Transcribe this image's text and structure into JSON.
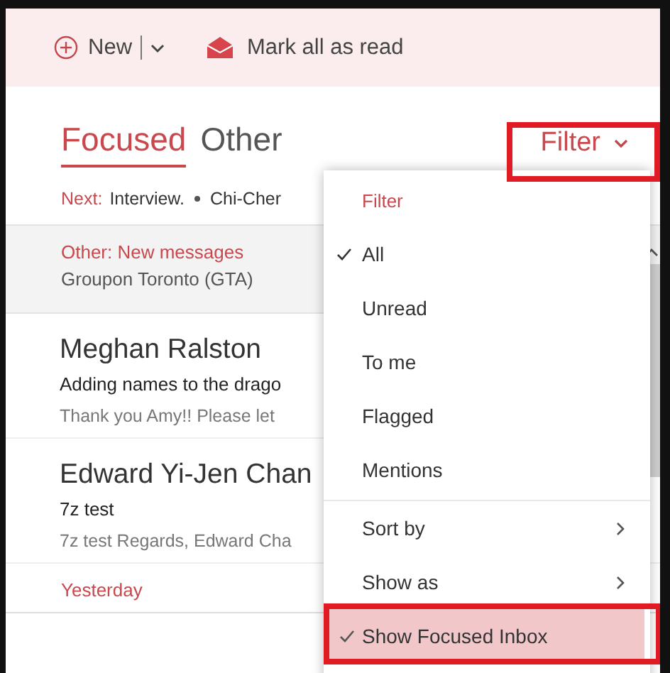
{
  "toolbar": {
    "new_label": "New",
    "mark_all_read_label": "Mark all as read"
  },
  "tabs": [
    {
      "label": "Focused",
      "selected": true
    },
    {
      "label": "Other",
      "selected": false
    }
  ],
  "filter_button": {
    "label": "Filter"
  },
  "next_line": {
    "prefix": "Next:",
    "event": "Interview.",
    "other": "Chi-Cher"
  },
  "other_banner": {
    "title": "Other: New messages",
    "sender": "Groupon Toronto (GTA)"
  },
  "messages": [
    {
      "sender": "Meghan Ralston",
      "subject": "Adding names to the drago",
      "preview": "Thank you Amy!! Please let"
    },
    {
      "sender": "Edward Yi-Jen Chan",
      "subject": "7z test",
      "preview": "7z test Regards, Edward Cha"
    }
  ],
  "section_header": "Yesterday",
  "filter_menu": {
    "items": [
      {
        "kind": "header",
        "label": "Filter"
      },
      {
        "kind": "option",
        "label": "All",
        "checked": true
      },
      {
        "kind": "option",
        "label": "Unread",
        "checked": false
      },
      {
        "kind": "option",
        "label": "To me",
        "checked": false
      },
      {
        "kind": "option",
        "label": "Flagged",
        "checked": false
      },
      {
        "kind": "option",
        "label": "Mentions",
        "checked": false
      },
      {
        "kind": "submenu",
        "label": "Sort by"
      },
      {
        "kind": "submenu",
        "label": "Show as"
      },
      {
        "kind": "toggle",
        "label": "Show Focused Inbox",
        "checked": true
      }
    ]
  }
}
